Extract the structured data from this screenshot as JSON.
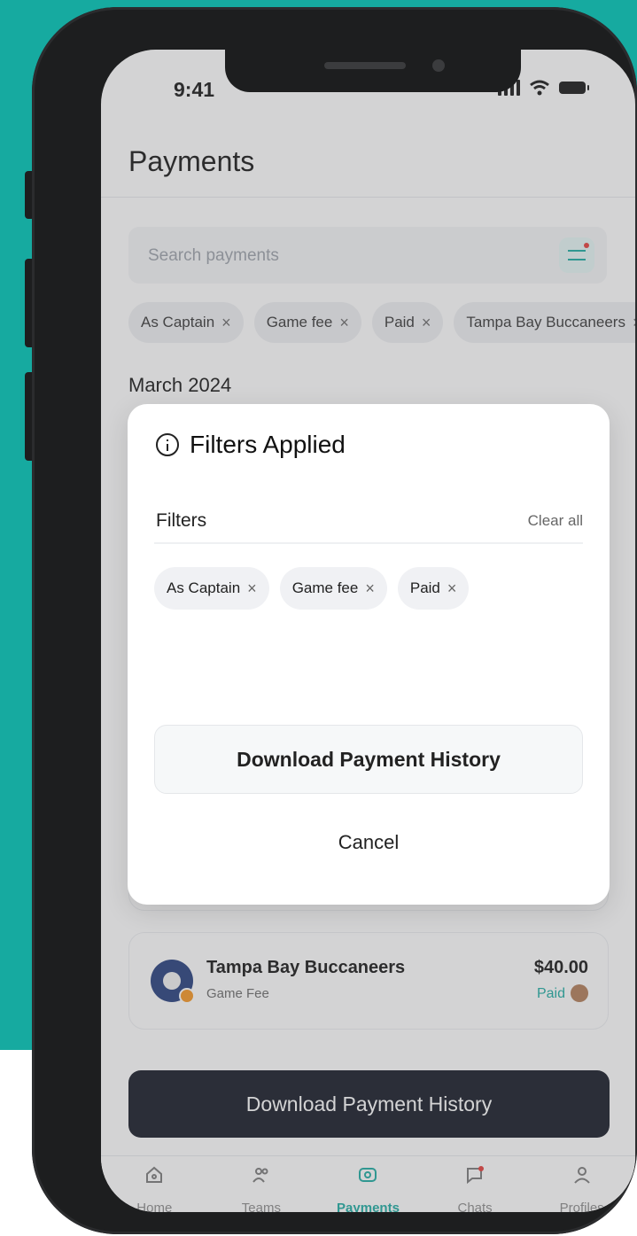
{
  "status": {
    "time": "9:41"
  },
  "header": {
    "title": "Payments"
  },
  "search": {
    "placeholder": "Search payments"
  },
  "filter_chips": [
    "As Captain",
    "Game fee",
    "Paid",
    "Tampa Bay Buccaneers"
  ],
  "section": {
    "label": "March 2024"
  },
  "payments": [
    {
      "team": "Tampa Bay Buccaneers",
      "type": "Game Fee",
      "amount": "$40.00",
      "status": "Paid"
    }
  ],
  "cta": {
    "label": "Download Payment History"
  },
  "tabs": [
    "Home",
    "Teams",
    "Payments",
    "Chats",
    "Profiles"
  ],
  "modal": {
    "title": "Filters Applied",
    "filters_label": "Filters",
    "clear_label": "Clear all",
    "chips": [
      "As Captain",
      "Game fee",
      "Paid"
    ],
    "download_label": "Download Payment History",
    "cancel_label": "Cancel"
  },
  "colors": {
    "accent": "#16aaa0",
    "background": "#16aaa0",
    "cta": "#0f1420"
  }
}
